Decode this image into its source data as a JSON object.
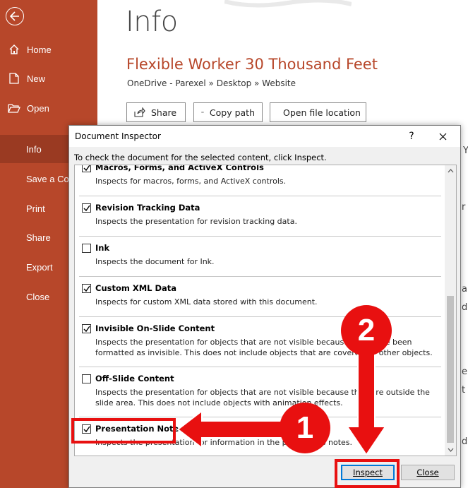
{
  "sidebar": {
    "back_icon": "back-arrow-icon",
    "items": [
      {
        "label": "Home",
        "icon": "home-icon"
      },
      {
        "label": "New",
        "icon": "new-document-icon"
      },
      {
        "label": "Open",
        "icon": "folder-open-icon"
      },
      {
        "label": "Info",
        "icon": ""
      },
      {
        "label": "Save a Copy",
        "icon": ""
      },
      {
        "label": "Print",
        "icon": ""
      },
      {
        "label": "Share",
        "icon": ""
      },
      {
        "label": "Export",
        "icon": ""
      },
      {
        "label": "Close",
        "icon": ""
      }
    ],
    "selected": "Info"
  },
  "main": {
    "page_title": "Info",
    "doc_title": "Flexible Worker 30 Thousand Feet",
    "doc_path": "OneDrive - Parexel » Desktop » Website",
    "buttons": {
      "share": "Share",
      "copy_path": "Copy path",
      "open_file_location": "Open file location"
    }
  },
  "dialog": {
    "title": "Document Inspector",
    "help": "?",
    "instruction": "To check the document for the selected content, click Inspect.",
    "items": [
      {
        "title": "Macros, Forms, and ActiveX Controls",
        "desc": "Inspects for macros, forms, and ActiveX controls.",
        "checked": true
      },
      {
        "title": "Revision Tracking Data",
        "desc": "Inspects the presentation for revision tracking data.",
        "checked": true
      },
      {
        "title": "Ink",
        "desc": "Inspects the document for Ink.",
        "checked": false
      },
      {
        "title": "Custom XML Data",
        "desc": "Inspects for custom XML data stored with this document.",
        "checked": true
      },
      {
        "title": "Invisible On-Slide Content",
        "desc": "Inspects the presentation for objects that are not visible because they have been formatted as invisible. This does not include objects that are covered by other objects.",
        "checked": true
      },
      {
        "title": "Off-Slide Content",
        "desc": "Inspects the presentation for objects that are not visible because they are outside the slide area.  This does not include objects with animation effects.",
        "checked": false
      },
      {
        "title": "Presentation Notes",
        "desc": "Inspects the presentation for information in the presenter's notes.",
        "checked": true
      }
    ],
    "buttons": {
      "inspect": "Inspect",
      "close": "Close"
    }
  },
  "annotations": {
    "step1": "1",
    "step2": "2",
    "color": "#e81010"
  },
  "colors": {
    "sidebar": "#b7472a",
    "sidebar_selected": "#9a3a22",
    "accent_title": "#b7472a"
  }
}
